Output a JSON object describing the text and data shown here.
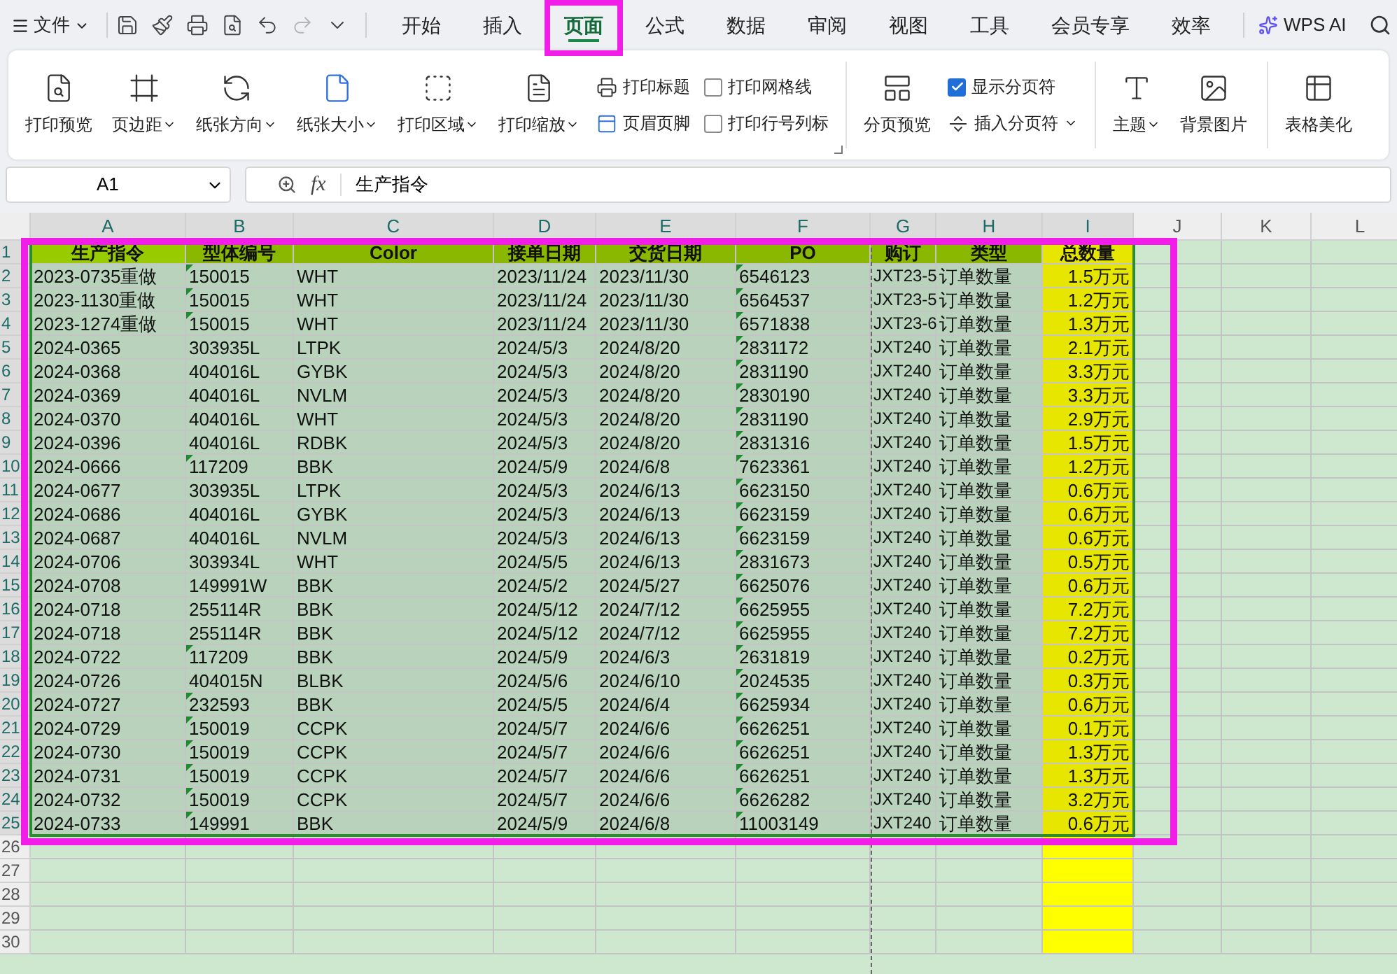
{
  "top_bar": {
    "file_menu": "文件",
    "tabs": [
      {
        "label": "开始",
        "selected": false,
        "highlighted": false
      },
      {
        "label": "插入",
        "selected": false,
        "highlighted": false
      },
      {
        "label": "页面",
        "selected": true,
        "highlighted": true
      },
      {
        "label": "公式",
        "selected": false,
        "highlighted": false
      },
      {
        "label": "数据",
        "selected": false,
        "highlighted": false
      },
      {
        "label": "审阅",
        "selected": false,
        "highlighted": false
      },
      {
        "label": "视图",
        "selected": false,
        "highlighted": false
      },
      {
        "label": "工具",
        "selected": false,
        "highlighted": false
      },
      {
        "label": "会员专享",
        "selected": false,
        "highlighted": false
      },
      {
        "label": "效率",
        "selected": false,
        "highlighted": false
      }
    ],
    "ai_button": "WPS AI"
  },
  "ribbon": {
    "groups": [
      {
        "items": [
          {
            "kind": "large",
            "label": "打印预览",
            "dropdown": false
          },
          {
            "kind": "large",
            "label": "页边距",
            "dropdown": true
          },
          {
            "kind": "large",
            "label": "纸张方向",
            "dropdown": true
          },
          {
            "kind": "large",
            "label": "纸张大小",
            "dropdown": true
          },
          {
            "kind": "large",
            "label": "打印区域",
            "dropdown": true
          },
          {
            "kind": "large",
            "label": "打印缩放",
            "dropdown": true
          },
          {
            "kind": "stack",
            "items": [
              {
                "kind": "small",
                "label": "打印标题",
                "dropdown": false
              },
              {
                "kind": "small",
                "label": "页眉页脚",
                "dropdown": false
              }
            ]
          },
          {
            "kind": "stack",
            "items": [
              {
                "kind": "check",
                "label": "打印网格线",
                "checked": false
              },
              {
                "kind": "check",
                "label": "打印行号列标",
                "checked": false
              }
            ]
          }
        ],
        "launcher": true
      },
      {
        "items": [
          {
            "kind": "large",
            "label": "分页预览",
            "dropdown": false
          },
          {
            "kind": "stack",
            "items": [
              {
                "kind": "check",
                "label": "显示分页符",
                "checked": true
              },
              {
                "kind": "small",
                "label": "插入分页符",
                "dropdown": true
              }
            ]
          }
        ]
      },
      {
        "items": [
          {
            "kind": "large",
            "label": "主题",
            "dropdown": true
          },
          {
            "kind": "large",
            "label": "背景图片",
            "dropdown": false
          }
        ]
      },
      {
        "items": [
          {
            "kind": "large",
            "label": "表格美化",
            "dropdown": false
          }
        ]
      }
    ]
  },
  "formula_bar": {
    "cell_ref": "A1",
    "function_label": "fx",
    "content": "生产指令"
  },
  "sheet": {
    "highlighted": true,
    "columns": [
      {
        "label": "A",
        "selected": true
      },
      {
        "label": "B",
        "selected": true
      },
      {
        "label": "C",
        "selected": true
      },
      {
        "label": "D",
        "selected": true
      },
      {
        "label": "E",
        "selected": true
      },
      {
        "label": "F",
        "selected": true
      },
      {
        "label": "G",
        "selected": true
      },
      {
        "label": "H",
        "selected": true
      },
      {
        "label": "I",
        "selected": true
      },
      {
        "label": "J",
        "selected": false
      },
      {
        "label": "K",
        "selected": false
      },
      {
        "label": "L",
        "selected": false
      }
    ],
    "header_row": {
      "n": "1",
      "selected": true,
      "cells": [
        "生产指令",
        "型体编号",
        "Color",
        "接单日期",
        "交货日期",
        "PO",
        "购订",
        "类型",
        "总数量"
      ]
    },
    "rows": [
      {
        "n": "2",
        "selected": true,
        "b_flag": true,
        "po_flag": true,
        "cells": [
          "2023-0735重做",
          "150015",
          "WHT",
          "2023/11/24",
          "2023/11/30",
          "6546123",
          "JXT23-5",
          "订单数量",
          "1.5万元"
        ]
      },
      {
        "n": "3",
        "selected": true,
        "b_flag": true,
        "po_flag": true,
        "cells": [
          "2023-1130重做",
          "150015",
          "WHT",
          "2023/11/24",
          "2023/11/30",
          "6564537",
          "JXT23-5",
          "订单数量",
          "1.2万元"
        ]
      },
      {
        "n": "4",
        "selected": true,
        "b_flag": true,
        "po_flag": true,
        "cells": [
          "2023-1274重做",
          "150015",
          "WHT",
          "2023/11/24",
          "2023/11/30",
          "6571838",
          "JXT23-6",
          "订单数量",
          "1.3万元"
        ]
      },
      {
        "n": "5",
        "selected": true,
        "b_flag": false,
        "po_flag": true,
        "cells": [
          "2024-0365",
          "303935L",
          "LTPK",
          "2024/5/3",
          "2024/8/20",
          "2831172",
          "JXT240",
          "订单数量",
          "2.1万元"
        ]
      },
      {
        "n": "6",
        "selected": true,
        "b_flag": false,
        "po_flag": true,
        "cells": [
          "2024-0368",
          "404016L",
          "GYBK",
          "2024/5/3",
          "2024/8/20",
          "2831190",
          "JXT240",
          "订单数量",
          "3.3万元"
        ]
      },
      {
        "n": "7",
        "selected": true,
        "b_flag": false,
        "po_flag": true,
        "cells": [
          "2024-0369",
          "404016L",
          "NVLM",
          "2024/5/3",
          "2024/8/20",
          "2830190",
          "JXT240",
          "订单数量",
          "3.3万元"
        ]
      },
      {
        "n": "8",
        "selected": true,
        "b_flag": false,
        "po_flag": true,
        "cells": [
          "2024-0370",
          "404016L",
          "WHT",
          "2024/5/3",
          "2024/8/20",
          "2831190",
          "JXT240",
          "订单数量",
          "2.9万元"
        ]
      },
      {
        "n": "9",
        "selected": true,
        "b_flag": false,
        "po_flag": true,
        "cells": [
          "2024-0396",
          "404016L",
          "RDBK",
          "2024/5/3",
          "2024/8/20",
          "2831316",
          "JXT240",
          "订单数量",
          "1.5万元"
        ]
      },
      {
        "n": "10",
        "selected": true,
        "b_flag": true,
        "po_flag": true,
        "cells": [
          "2024-0666",
          "117209",
          "BBK",
          "2024/5/9",
          "2024/6/8",
          "7623361",
          "JXT240",
          "订单数量",
          "1.2万元"
        ]
      },
      {
        "n": "11",
        "selected": true,
        "b_flag": false,
        "po_flag": true,
        "cells": [
          "2024-0677",
          "303935L",
          "LTPK",
          "2024/5/3",
          "2024/6/13",
          "6623150",
          "JXT240",
          "订单数量",
          "0.6万元"
        ]
      },
      {
        "n": "12",
        "selected": true,
        "b_flag": false,
        "po_flag": true,
        "cells": [
          "2024-0686",
          "404016L",
          "GYBK",
          "2024/5/3",
          "2024/6/13",
          "6623159",
          "JXT240",
          "订单数量",
          "0.6万元"
        ]
      },
      {
        "n": "13",
        "selected": true,
        "b_flag": false,
        "po_flag": true,
        "cells": [
          "2024-0687",
          "404016L",
          "NVLM",
          "2024/5/3",
          "2024/6/13",
          "6623159",
          "JXT240",
          "订单数量",
          "0.6万元"
        ]
      },
      {
        "n": "14",
        "selected": true,
        "b_flag": false,
        "po_flag": true,
        "cells": [
          "2024-0706",
          "303934L",
          "WHT",
          "2024/5/5",
          "2024/6/13",
          "2831673",
          "JXT240",
          "订单数量",
          "0.5万元"
        ]
      },
      {
        "n": "15",
        "selected": true,
        "b_flag": false,
        "po_flag": true,
        "cells": [
          "2024-0708",
          "149991W",
          "BBK",
          "2024/5/2",
          "2024/5/27",
          "6625076",
          "JXT240",
          "订单数量",
          "0.6万元"
        ]
      },
      {
        "n": "16",
        "selected": true,
        "b_flag": false,
        "po_flag": true,
        "cells": [
          "2024-0718",
          "255114R",
          "BBK",
          "2024/5/12",
          "2024/7/12",
          "6625955",
          "JXT240",
          "订单数量",
          "7.2万元"
        ]
      },
      {
        "n": "17",
        "selected": true,
        "b_flag": false,
        "po_flag": true,
        "cells": [
          "2024-0718",
          "255114R",
          "BBK",
          "2024/5/12",
          "2024/7/12",
          "6625955",
          "JXT240",
          "订单数量",
          "7.2万元"
        ]
      },
      {
        "n": "18",
        "selected": true,
        "b_flag": true,
        "po_flag": true,
        "cells": [
          "2024-0722",
          "117209",
          "BBK",
          "2024/5/9",
          "2024/6/3",
          "2631819",
          "JXT240",
          "订单数量",
          "0.2万元"
        ]
      },
      {
        "n": "19",
        "selected": true,
        "b_flag": false,
        "po_flag": true,
        "cells": [
          "2024-0726",
          "404015N",
          "BLBK",
          "2024/5/6",
          "2024/6/10",
          "2024535",
          "JXT240",
          "订单数量",
          "0.3万元"
        ]
      },
      {
        "n": "20",
        "selected": true,
        "b_flag": true,
        "po_flag": true,
        "cells": [
          "2024-0727",
          "232593",
          "BBK",
          "2024/5/5",
          "2024/6/4",
          "6625934",
          "JXT240",
          "订单数量",
          "0.6万元"
        ]
      },
      {
        "n": "21",
        "selected": true,
        "b_flag": true,
        "po_flag": true,
        "cells": [
          "2024-0729",
          "150019",
          "CCPK",
          "2024/5/7",
          "2024/6/6",
          "6626251",
          "JXT240",
          "订单数量",
          "0.1万元"
        ]
      },
      {
        "n": "22",
        "selected": true,
        "b_flag": true,
        "po_flag": true,
        "cells": [
          "2024-0730",
          "150019",
          "CCPK",
          "2024/5/7",
          "2024/6/6",
          "6626251",
          "JXT240",
          "订单数量",
          "1.3万元"
        ]
      },
      {
        "n": "23",
        "selected": true,
        "b_flag": true,
        "po_flag": true,
        "cells": [
          "2024-0731",
          "150019",
          "CCPK",
          "2024/5/7",
          "2024/6/6",
          "6626251",
          "JXT240",
          "订单数量",
          "1.3万元"
        ]
      },
      {
        "n": "24",
        "selected": true,
        "b_flag": true,
        "po_flag": true,
        "cells": [
          "2024-0732",
          "150019",
          "CCPK",
          "2024/5/7",
          "2024/6/6",
          "6626282",
          "JXT240",
          "订单数量",
          "3.2万元"
        ]
      },
      {
        "n": "25",
        "selected": true,
        "b_flag": true,
        "po_flag": true,
        "cells": [
          "2024-0733",
          "149991",
          "BBK",
          "2024/5/9",
          "2024/6/8",
          "11003149",
          "JXT240",
          "订单数量",
          "0.6万元"
        ]
      }
    ],
    "empty_rows": [
      {
        "n": "26",
        "selected": false
      },
      {
        "n": "27",
        "selected": false
      },
      {
        "n": "28",
        "selected": false
      },
      {
        "n": "29",
        "selected": false
      },
      {
        "n": "30",
        "selected": false
      }
    ]
  }
}
